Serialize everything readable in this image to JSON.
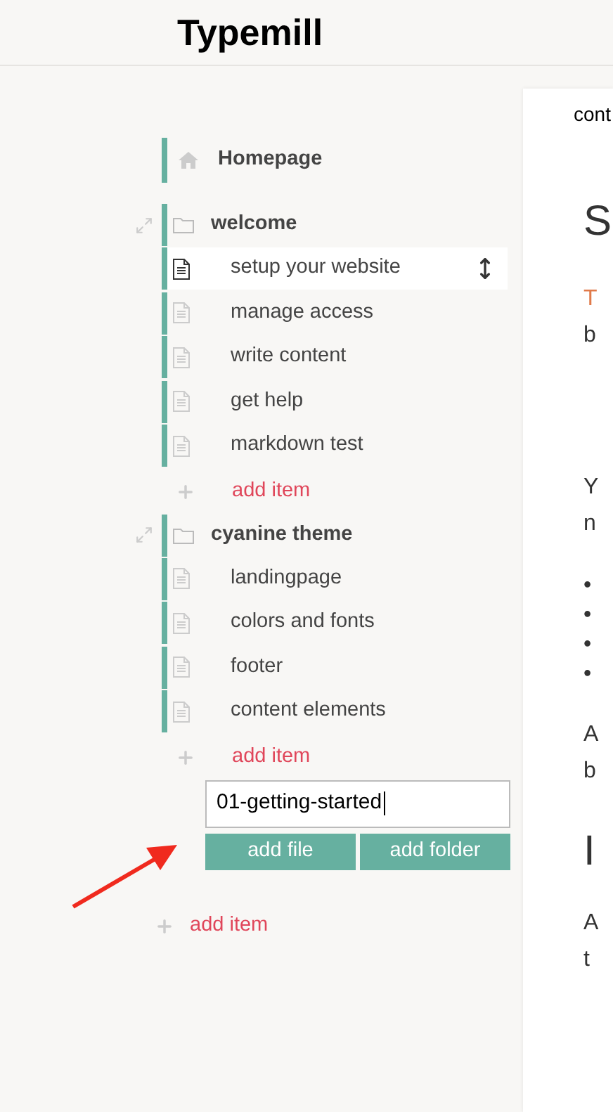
{
  "header": {
    "title": "Typemill"
  },
  "nav": {
    "items": [
      {
        "kind": "home",
        "label": "Homepage"
      },
      {
        "kind": "folder",
        "label": "welcome",
        "children": [
          {
            "kind": "page",
            "label": "setup your website",
            "selected": true
          },
          {
            "kind": "page",
            "label": "manage access",
            "selected": false
          },
          {
            "kind": "page",
            "label": "write content",
            "selected": false
          },
          {
            "kind": "page",
            "label": "get help",
            "selected": false
          },
          {
            "kind": "page",
            "label": "markdown test",
            "selected": false
          },
          {
            "kind": "add",
            "label": "add item"
          }
        ]
      },
      {
        "kind": "folder",
        "label": "cyanine theme",
        "children": [
          {
            "kind": "page",
            "label": "landingpage",
            "selected": false
          },
          {
            "kind": "page",
            "label": "colors and fonts",
            "selected": false
          },
          {
            "kind": "page",
            "label": "footer",
            "selected": false
          },
          {
            "kind": "page",
            "label": "content elements",
            "selected": false
          },
          {
            "kind": "add",
            "label": "add item"
          },
          {
            "kind": "form",
            "value": "01-getting-started",
            "buttons": [
              "add file",
              "add folder"
            ]
          }
        ]
      },
      {
        "kind": "root-add",
        "label": "add item"
      }
    ]
  },
  "content": {
    "tab": "cont",
    "fragments": [
      {
        "kind": "heading",
        "text": "S"
      },
      {
        "kind": "link",
        "text": "T"
      },
      {
        "kind": "text",
        "text": "b"
      },
      {
        "kind": "gap"
      },
      {
        "kind": "text",
        "text": "Y"
      },
      {
        "kind": "text",
        "text": "n"
      },
      {
        "kind": "gap-small"
      },
      {
        "kind": "bullet",
        "text": "•"
      },
      {
        "kind": "bullet",
        "text": "•"
      },
      {
        "kind": "bullet",
        "text": "•"
      },
      {
        "kind": "bullet",
        "text": "•"
      },
      {
        "kind": "gap-small"
      },
      {
        "kind": "text",
        "text": "A"
      },
      {
        "kind": "text",
        "text": "b"
      },
      {
        "kind": "heading2",
        "text": "I"
      },
      {
        "kind": "text",
        "text": "A"
      },
      {
        "kind": "text",
        "text": "t"
      }
    ]
  }
}
